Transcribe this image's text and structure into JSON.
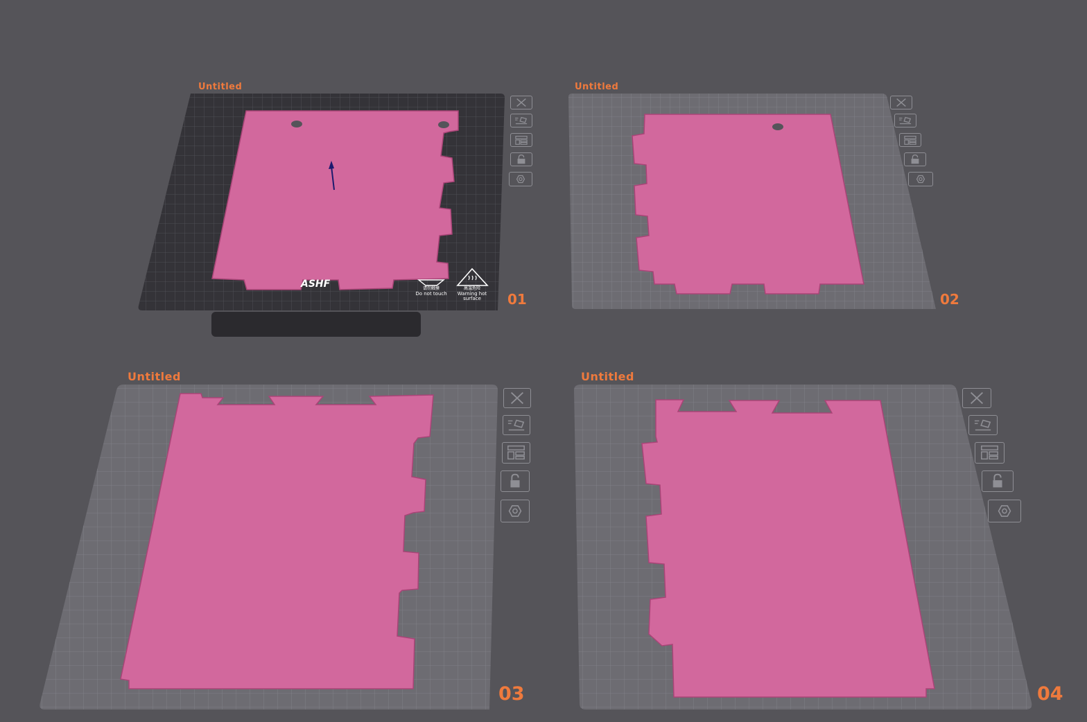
{
  "plates": [
    {
      "id": "plate-1",
      "title": "Untitled",
      "number": "01",
      "active": true
    },
    {
      "id": "plate-2",
      "title": "Untitled",
      "number": "02",
      "active": false
    },
    {
      "id": "plate-3",
      "title": "Untitled",
      "number": "03",
      "active": false
    },
    {
      "id": "plate-4",
      "title": "Untitled",
      "number": "04",
      "active": false
    }
  ],
  "bed": {
    "brand": "ASHF",
    "warning_cn": "请勿触摸",
    "warning_en": "Do not touch",
    "hot_cn": "高温危险",
    "hot_en_1": "Warning hot",
    "hot_en_2": "surface"
  },
  "plate_tools": [
    {
      "name": "delete-plate",
      "icon": "close-icon"
    },
    {
      "name": "auto-orient",
      "icon": "auto-orient-icon"
    },
    {
      "name": "arrange",
      "icon": "arrange-icon"
    },
    {
      "name": "lock-plate",
      "icon": "lock-icon"
    },
    {
      "name": "plate-settings",
      "icon": "hexagon-settings-icon"
    }
  ],
  "colors": {
    "background": "#555459",
    "accent": "#ef7a3d",
    "part": "#d2689d",
    "part_edge": "#a94477",
    "plate_light": "#6d6c72",
    "plate_dark": "#343338"
  }
}
